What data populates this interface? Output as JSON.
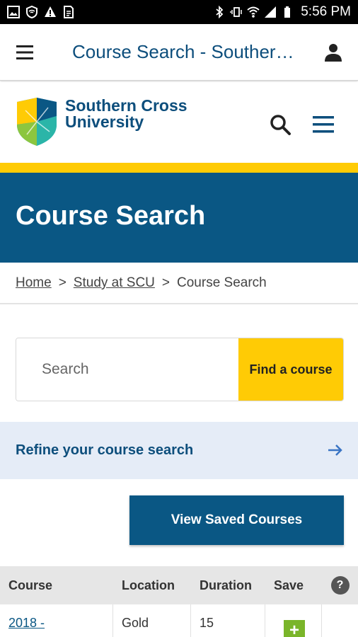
{
  "status_bar": {
    "icons_left": [
      "image-icon",
      "shield-wifi-icon",
      "warning-icon",
      "document-icon"
    ],
    "icons_right": [
      "bluetooth-icon",
      "vibrate-icon",
      "wifi-icon",
      "signal-icon",
      "battery-icon"
    ],
    "time": "5:56 PM"
  },
  "app_bar": {
    "title": "Course Search - Souther…"
  },
  "site_header": {
    "brand_line1": "Southern Cross",
    "brand_line2": "University"
  },
  "hero": {
    "title": "Course Search"
  },
  "breadcrumb": {
    "items": [
      "Home",
      "Study at SCU",
      "Course Search"
    ],
    "separator": ">"
  },
  "search": {
    "placeholder": "Search",
    "button_label": "Find a course"
  },
  "refine": {
    "label": "Refine your course search"
  },
  "saved": {
    "label": "View Saved Courses"
  },
  "table": {
    "headers": [
      "Course",
      "Location",
      "Duration",
      "Save"
    ],
    "help": "?",
    "rows": [
      {
        "course": "2018 -",
        "location": "Gold",
        "duration": "15",
        "save": "+"
      }
    ]
  },
  "colors": {
    "brand_blue": "#0a5784",
    "accent_yellow": "#ffcb05",
    "refine_bg": "#e5ecf7",
    "save_green": "#7ab52a"
  }
}
